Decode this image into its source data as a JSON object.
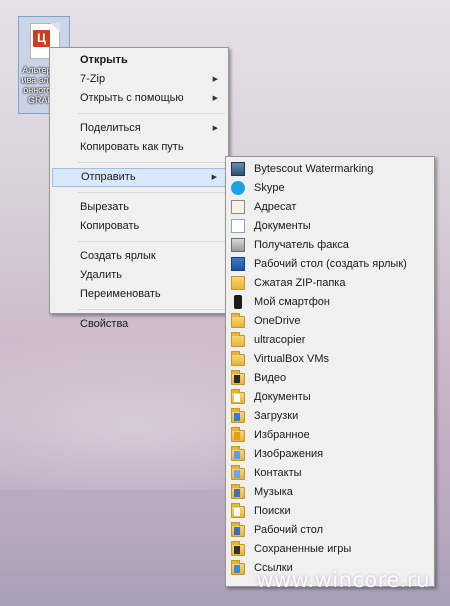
{
  "desktop_file": {
    "label": "Альтернатива электронного LA GRANA"
  },
  "context_menu": [
    {
      "label": "Открыть",
      "bold": true
    },
    {
      "label": "7-Zip",
      "submenu": true
    },
    {
      "label": "Открыть с помощью",
      "submenu": true
    },
    {
      "sep": true
    },
    {
      "label": "Поделиться",
      "submenu": true
    },
    {
      "label": "Копировать как путь"
    },
    {
      "sep": true
    },
    {
      "label": "Отправить",
      "submenu": true,
      "highlighted": true
    },
    {
      "sep": true
    },
    {
      "label": "Вырезать"
    },
    {
      "label": "Копировать"
    },
    {
      "sep": true
    },
    {
      "label": "Создать ярлык"
    },
    {
      "label": "Удалить"
    },
    {
      "label": "Переименовать"
    },
    {
      "sep": true
    },
    {
      "label": "Свойства"
    }
  ],
  "send_to_menu": [
    {
      "label": "Bytescout Watermarking",
      "icon": "bytescout-icon"
    },
    {
      "label": "Skype",
      "icon": "skype-icon"
    },
    {
      "label": "Адресат",
      "icon": "mail-recipient-icon"
    },
    {
      "label": "Документы",
      "icon": "documents-icon"
    },
    {
      "label": "Получатель факса",
      "icon": "fax-icon"
    },
    {
      "label": "Рабочий стол (создать ярлык)",
      "icon": "desktop-icon"
    },
    {
      "label": "Сжатая ZIP-папка",
      "icon": "zip-folder-icon"
    },
    {
      "label": "Мой смартфон",
      "icon": "smartphone-icon"
    },
    {
      "label": "OneDrive",
      "icon": "folder-icon"
    },
    {
      "label": "ultracopier",
      "icon": "folder-icon"
    },
    {
      "label": "VirtualBox VMs",
      "icon": "folder-icon"
    },
    {
      "label": "Видео",
      "icon": "video-folder-icon"
    },
    {
      "label": "Документы",
      "icon": "documents-folder-icon"
    },
    {
      "label": "Загрузки",
      "icon": "downloads-folder-icon"
    },
    {
      "label": "Избранное",
      "icon": "favorites-folder-icon"
    },
    {
      "label": "Изображения",
      "icon": "pictures-folder-icon"
    },
    {
      "label": "Контакты",
      "icon": "contacts-folder-icon"
    },
    {
      "label": "Музыка",
      "icon": "music-folder-icon"
    },
    {
      "label": "Поиски",
      "icon": "searches-folder-icon"
    },
    {
      "label": "Рабочий стол",
      "icon": "desktop-folder-icon"
    },
    {
      "label": "Сохраненные игры",
      "icon": "saved-games-folder-icon"
    },
    {
      "label": "Ссылки",
      "icon": "links-folder-icon"
    }
  ],
  "watermark": "www.wincore.ru"
}
